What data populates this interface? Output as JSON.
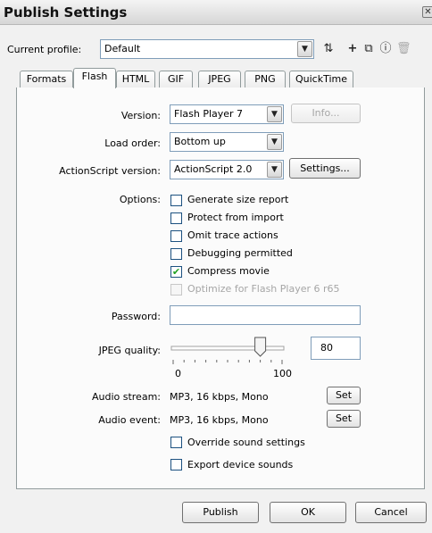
{
  "window": {
    "title": "Publish Settings"
  },
  "profile": {
    "label": "Current profile:",
    "value": "Default"
  },
  "tabs": [
    "Formats",
    "Flash",
    "HTML",
    "GIF",
    "JPEG",
    "PNG",
    "QuickTime"
  ],
  "version": {
    "label": "Version:",
    "value": "Flash Player 7",
    "info_button": "Info..."
  },
  "load_order": {
    "label": "Load order:",
    "value": "Bottom up"
  },
  "actionscript": {
    "label": "ActionScript version:",
    "value": "ActionScript 2.0",
    "settings_button": "Settings..."
  },
  "options": {
    "label": "Options:",
    "items": [
      {
        "label": "Generate size report",
        "checked": false,
        "enabled": true
      },
      {
        "label": "Protect from import",
        "checked": false,
        "enabled": true
      },
      {
        "label": "Omit trace actions",
        "checked": false,
        "enabled": true
      },
      {
        "label": "Debugging permitted",
        "checked": false,
        "enabled": true
      },
      {
        "label": "Compress movie",
        "checked": true,
        "enabled": true
      },
      {
        "label": "Optimize for Flash Player 6 r65",
        "checked": false,
        "enabled": false
      }
    ]
  },
  "password": {
    "label": "Password:",
    "value": ""
  },
  "jpeg_quality": {
    "label": "JPEG quality:",
    "value": "80",
    "min_label": "0",
    "max_label": "100",
    "slider_fraction": 0.8
  },
  "audio_stream": {
    "label": "Audio stream:",
    "value": "MP3, 16 kbps, Mono",
    "set_button": "Set"
  },
  "audio_event": {
    "label": "Audio event:",
    "value": "MP3, 16 kbps, Mono",
    "set_button": "Set"
  },
  "sound_options": [
    {
      "label": "Override sound settings",
      "checked": false
    },
    {
      "label": "Export device sounds",
      "checked": false
    }
  ],
  "footer": {
    "publish": "Publish",
    "ok": "OK",
    "cancel": "Cancel"
  },
  "icons": {
    "title_close": "close-icon",
    "toolbar": [
      "import-export-profile-icon",
      "add-profile-icon",
      "duplicate-profile-icon",
      "profile-properties-icon",
      "delete-profile-icon"
    ]
  }
}
